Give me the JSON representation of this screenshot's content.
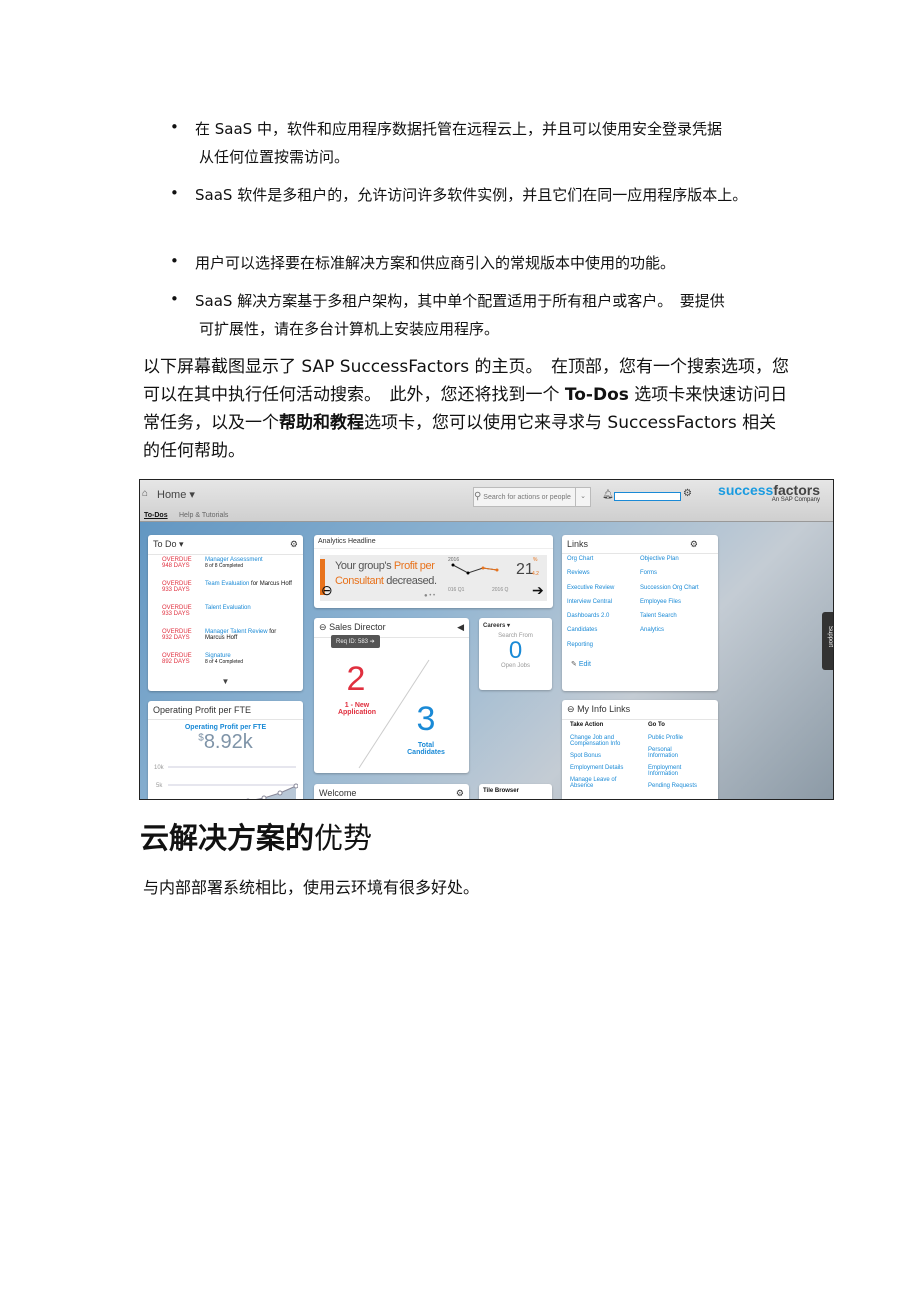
{
  "bullets": [
    {
      "line1": "在 SaaS 中，软件和应用程序数据托管在远程云上，并且可以使用安全登录凭据",
      "line2": "从任何位置按需访问。"
    },
    {
      "line1": "SaaS 软件是多租户的，允许访问许多软件实例，并且它们在同一应用程序版本上。",
      "line2": ""
    },
    {
      "line1": "用户可以选择要在标准解决方案和供应商引入的常规版本中使用的功能。",
      "line2": ""
    },
    {
      "line1": "SaaS 解决方案基于多租户架构，其中单个配置适用于所有租户或客户。　要提供",
      "line2": "可扩展性，请在多台计算机上安装应用程序。"
    }
  ],
  "paragraph": {
    "p1": "以下屏幕截图显示了 SAP SuccessFactors 的主页。　在顶部，您有一个搜索选项，您可以在其中执行任何活动搜索。　此外，您还将找到一个 ",
    "b1": "To-Dos",
    "p2": " 选项卡来快速访问日常任务，以及一个",
    "b2": "帮助和教程",
    "p3": "选项卡，您可以使用它来寻求与 SuccessFactors 相关的任何帮助。"
  },
  "heading": {
    "bold": "云解决方案的",
    "normal": "优势"
  },
  "closing": "与内部部署系统相比，使用云环境有很多好处。",
  "app": {
    "home": "Home ▾",
    "tabs": [
      "To-Dos",
      "Help & Tutorials"
    ],
    "search_placeholder": "Search for actions or people",
    "logo": {
      "a": "successfactors",
      "b": "An SAP Company"
    },
    "todo": {
      "title": "To Do ▾",
      "items": [
        {
          "s1": "OVERDUE",
          "s2": "948 DAYS",
          "link": "Manager Assessment",
          "rest": "",
          "sub": "8 of 8 Completed"
        },
        {
          "s1": "OVERDUE",
          "s2": "933 DAYS",
          "link": "Team Evaluation",
          "rest": " for Marcus Hoff",
          "sub": ""
        },
        {
          "s1": "OVERDUE",
          "s2": "933 DAYS",
          "link": "Talent Evaluation",
          "rest": "",
          "sub": ""
        },
        {
          "s1": "OVERDUE",
          "s2": "932 DAYS",
          "link": "Manager Talent Review",
          "rest": " for Marcus Hoff",
          "sub": ""
        },
        {
          "s1": "OVERDUE",
          "s2": "892 DAYS",
          "link": "Signature",
          "rest": "",
          "sub": "8 of 4 Completed"
        }
      ]
    },
    "analytics": {
      "title": "Analytics Headline",
      "t1": "Your group's ",
      "t2": "Profit per",
      "t3": "Consultant",
      "t4": " decreased.",
      "value": "21",
      "unit": "%",
      "delta": "4.2",
      "x1": "016 Q1",
      "x2": "2016 Q",
      "y": "2016"
    },
    "sales": {
      "title": "Sales Director",
      "req": "Req ID: 583 ➔",
      "n1": "2",
      "l1": "1 - New Application",
      "n2": "3",
      "l2": "Total Candidates"
    },
    "careers": {
      "title": "Careers ▾",
      "top": "Search From",
      "num": "0",
      "bottom": "Open Jobs"
    },
    "links": {
      "title": "Links",
      "col1": [
        "Org Chart",
        "Reviews",
        "Executive Review",
        "Interview Central",
        "Dashboards 2.0",
        "Candidates",
        "Reporting"
      ],
      "col2": [
        "Objective Plan",
        "Forms",
        "Succession Org Chart",
        "Employee Files",
        "Talent Search",
        "Analytics"
      ],
      "edit": "Edit"
    },
    "profit": {
      "title": "Operating Profit per FTE",
      "sub": "Operating Profit per FTE",
      "cur": "$",
      "value": "8.92k",
      "y1": "10k",
      "y2": "5k"
    },
    "welcome": "Welcome",
    "tile_browser": "Tile Browser",
    "myinfo": {
      "title": "My Info Links",
      "h1": "Take Action",
      "h2": "Go To",
      "col1": [
        "Change Job and Compensation Info",
        "Spot Bonus",
        "Employment Details",
        "Manage Leave of Absence"
      ],
      "col2": [
        "Public Profile",
        "Personal Information",
        "Employment Information",
        "Pending Requests"
      ]
    },
    "support": "Support",
    "colors": {
      "accent": "#1a8ad6",
      "overdue": "#e0303f",
      "orange": "#e8731d"
    }
  }
}
